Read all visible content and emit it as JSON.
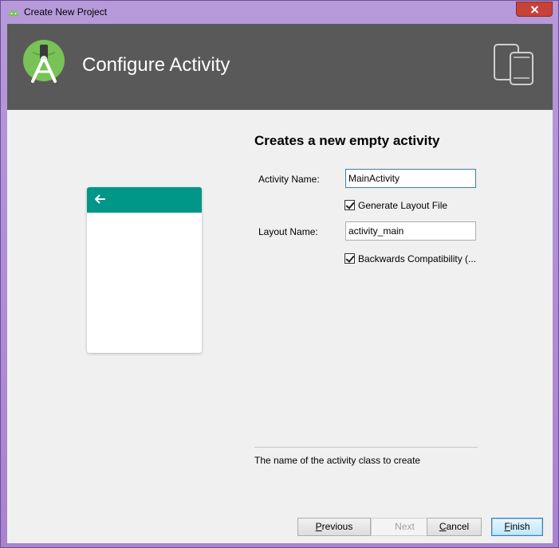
{
  "window": {
    "title": "Create New Project"
  },
  "header": {
    "title": "Configure Activity"
  },
  "form": {
    "heading": "Creates a new empty activity",
    "activity_name_label": "Activity Name:",
    "activity_name_value": "MainActivity",
    "generate_layout_label": "Generate Layout File",
    "generate_layout_checked": true,
    "layout_name_label": "Layout Name:",
    "layout_name_value": "activity_main",
    "backwards_compat_label": "Backwards Compatibility (...",
    "backwards_compat_checked": true,
    "description": "The name of the activity class to create"
  },
  "buttons": {
    "previous_first": "P",
    "previous_rest": "revious",
    "next": "Next",
    "cancel_first": "C",
    "cancel_rest": "ancel",
    "finish_first": "F",
    "finish_rest": "inish"
  },
  "colors": {
    "header_bg": "#595959",
    "preview_toolbar": "#009688",
    "logo_green": "#78c257"
  },
  "icons": [
    "android-icon",
    "android-studio-logo-icon",
    "phone-tablet-icon",
    "back-arrow-icon",
    "close-icon"
  ]
}
